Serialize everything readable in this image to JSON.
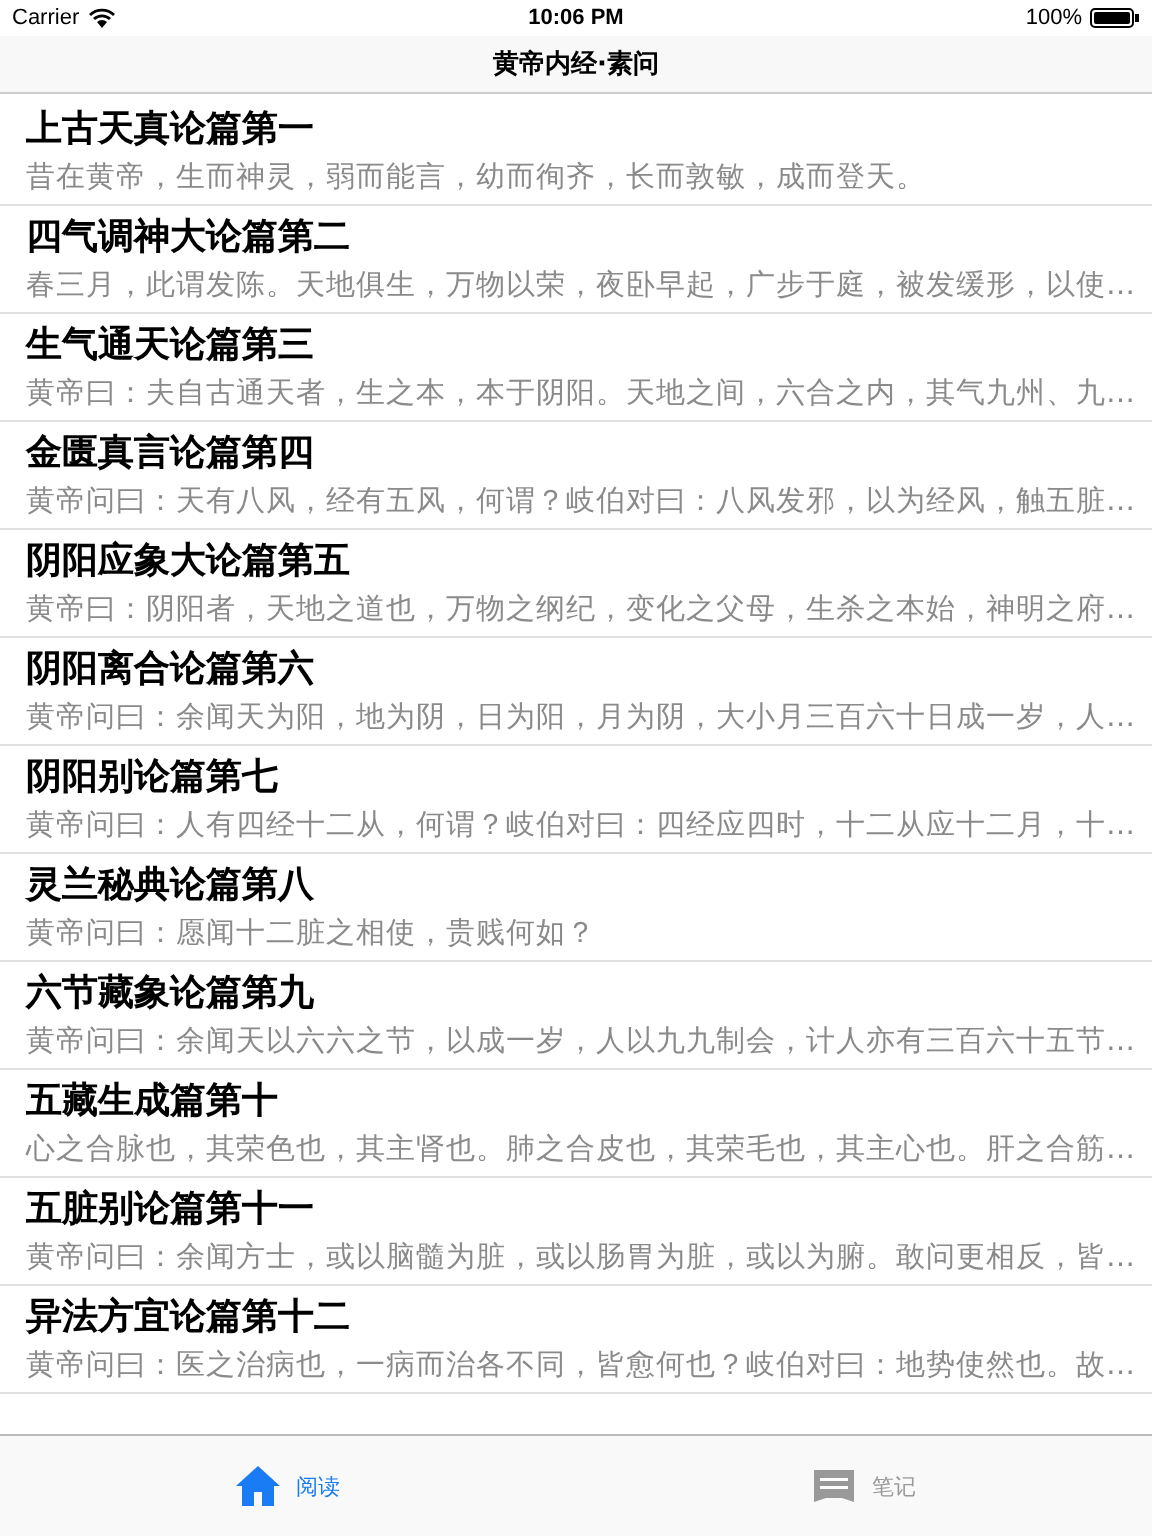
{
  "status_bar": {
    "carrier": "Carrier",
    "time": "10:06 PM",
    "battery": "100%"
  },
  "nav": {
    "title": "黄帝内经·素问"
  },
  "chapters": [
    {
      "title": "上古天真论篇第一",
      "excerpt": "昔在黄帝，生而神灵，弱而能言，幼而徇齐，长而敦敏，成而登天。"
    },
    {
      "title": "四气调神大论篇第二",
      "excerpt": "春三月，此谓发陈。天地俱生，万物以荣，夜卧早起，广步于庭，被发缓形，以使…"
    },
    {
      "title": "生气通天论篇第三",
      "excerpt": "黄帝曰：夫自古通天者，生之本，本于阴阳。天地之间，六合之内，其气九州、九…"
    },
    {
      "title": "金匮真言论篇第四",
      "excerpt": "黄帝问曰：天有八风，经有五风，何谓？岐伯对曰：八风发邪，以为经风，触五脏…"
    },
    {
      "title": "阴阳应象大论篇第五",
      "excerpt": "黄帝曰：阴阳者，天地之道也，万物之纲纪，变化之父母，生杀之本始，神明之府…"
    },
    {
      "title": "阴阳离合论篇第六",
      "excerpt": "黄帝问曰：余闻天为阳，地为阴，日为阳，月为阴，大小月三百六十日成一岁，人…"
    },
    {
      "title": "阴阳别论篇第七",
      "excerpt": "黄帝问曰：人有四经十二从，何谓？岐伯对曰：四经应四时，十二从应十二月，十…"
    },
    {
      "title": "灵兰秘典论篇第八",
      "excerpt": "黄帝问曰：愿闻十二脏之相使，贵贱何如？"
    },
    {
      "title": "六节藏象论篇第九",
      "excerpt": "黄帝问曰：余闻天以六六之节，以成一岁，人以九九制会，计人亦有三百六十五节…"
    },
    {
      "title": "五藏生成篇第十",
      "excerpt": "心之合脉也，其荣色也，其主肾也。肺之合皮也，其荣毛也，其主心也。肝之合筋…"
    },
    {
      "title": "五脏别论篇第十一",
      "excerpt": "黄帝问曰：余闻方士，或以脑髓为脏，或以肠胃为脏，或以为腑。敢问更相反，皆…"
    },
    {
      "title": "异法方宜论篇第十二",
      "excerpt": "黄帝问曰：医之治病也，一病而治各不同，皆愈何也？岐伯对曰：地势使然也。故…"
    }
  ],
  "tab_bar": [
    {
      "label": "阅读",
      "kind": "home",
      "selected": true
    },
    {
      "label": "笔记",
      "kind": "notes",
      "selected": false
    }
  ]
}
